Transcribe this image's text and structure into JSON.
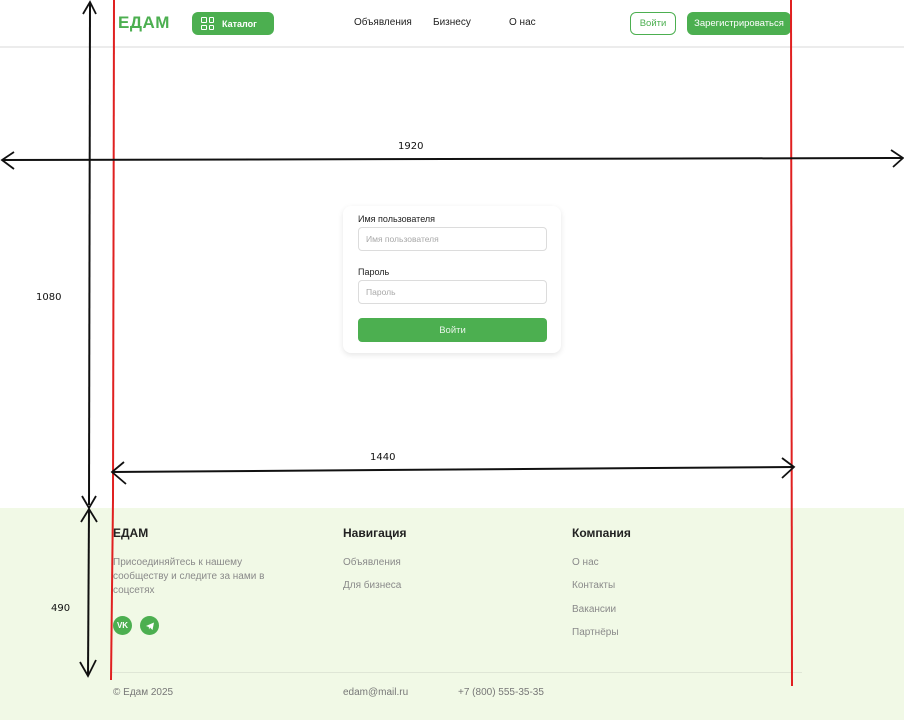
{
  "header": {
    "logo": "ЕДАМ",
    "catalog_label": "Каталог",
    "nav": [
      "Объявления",
      "Бизнесу",
      "О нас"
    ],
    "login_label": "Войти",
    "register_label": "Зарегистрироваться"
  },
  "login_form": {
    "username_label": "Имя пользователя",
    "username_placeholder": "Имя пользователя",
    "password_label": "Пароль",
    "password_placeholder": "Пароль",
    "submit_label": "Войти"
  },
  "annotations": {
    "width_full": "1920",
    "height_main": "1080",
    "width_content": "1440",
    "height_footer": "490"
  },
  "footer": {
    "brand": "ЕДАМ",
    "tagline": "Присоединяйтесь к нашему сообществу и следите за нами в соцсетях",
    "social": [
      {
        "icon": "vk-icon",
        "label": "VK"
      },
      {
        "icon": "telegram-icon",
        "label": "Telegram"
      }
    ],
    "navigation_title": "Навигация",
    "navigation_links": [
      "Объявления",
      "Для бизнеса"
    ],
    "company_title": "Компания",
    "company_links": [
      "О нас",
      "Контакты",
      "Вакансии",
      "Партнёры"
    ],
    "copyright": "©  Едам 2025",
    "email": "edam@mail.ru",
    "phone": "+7 (800) 555-35-35"
  },
  "colors": {
    "accent": "#4caf50",
    "footer_bg": "#f1f9e6",
    "annotation_red": "#e02020",
    "annotation_black": "#111111"
  }
}
